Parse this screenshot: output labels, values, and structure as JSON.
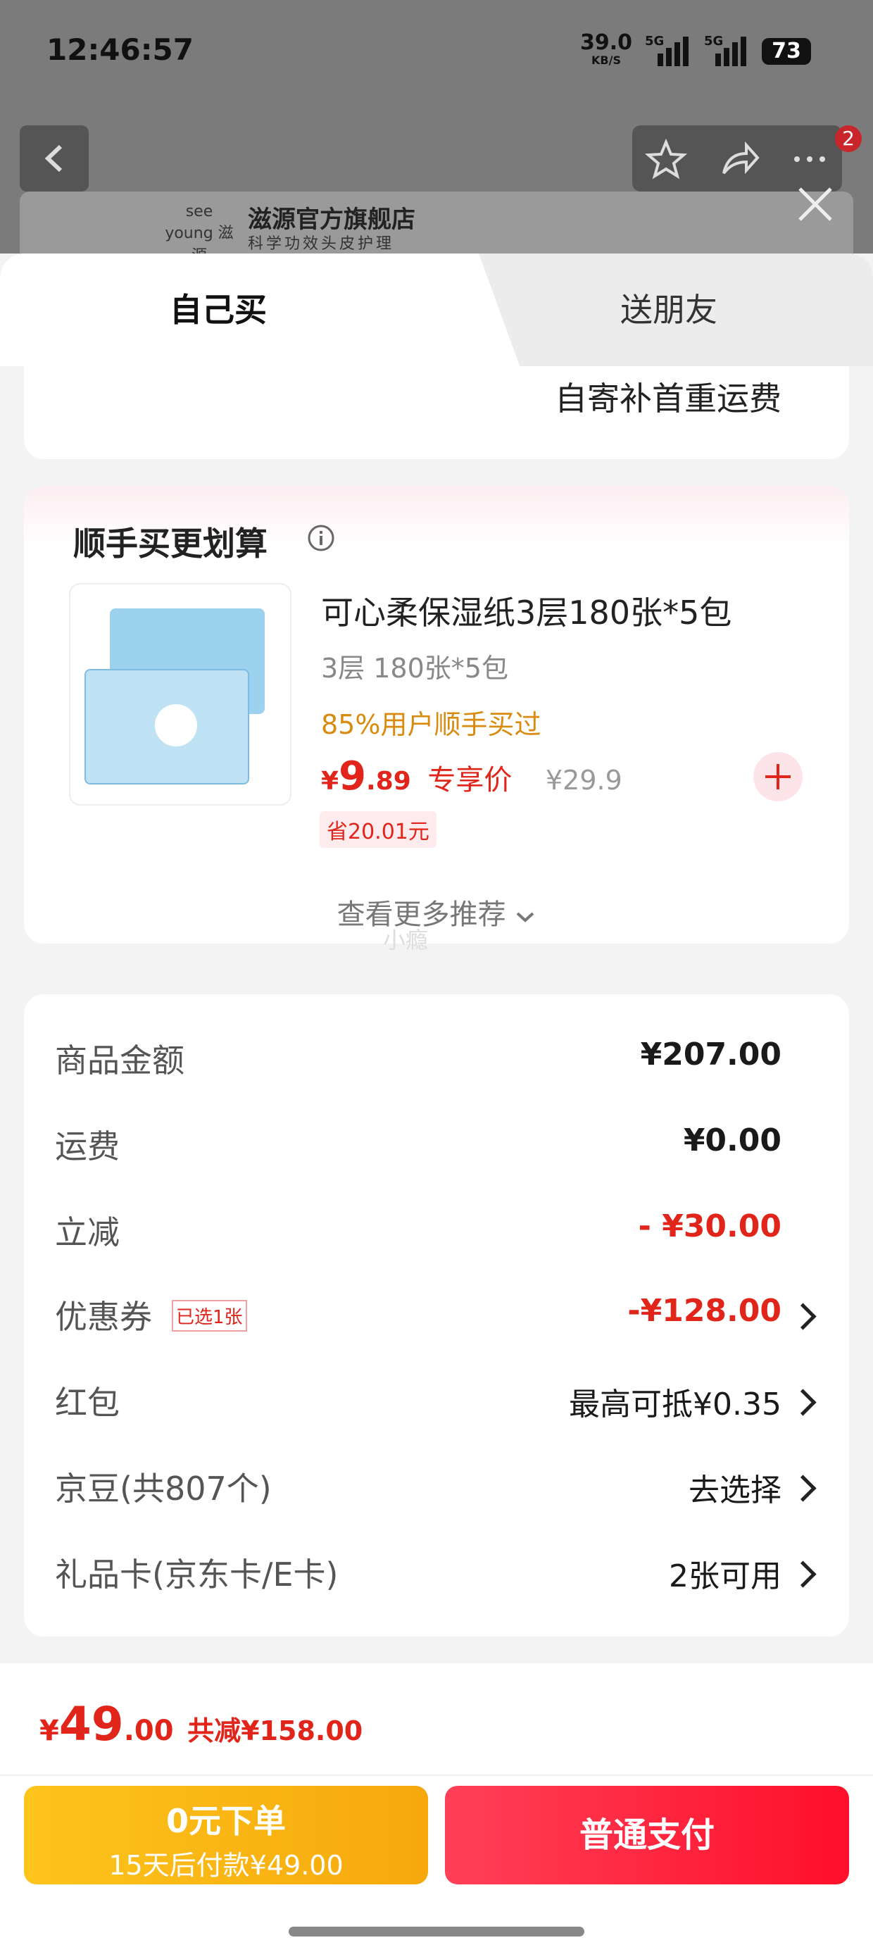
{
  "status_bar": {
    "time": "12:46:57",
    "net_speed": "39.0",
    "net_unit": "KB/S",
    "sig1": "5G",
    "sig2": "5G",
    "battery": "73"
  },
  "store": {
    "name": "滋源官方旗舰店",
    "slogan": "科学功效头皮护理",
    "brand": "see young 滋源"
  },
  "nav": {
    "badge": "2"
  },
  "tabs": {
    "self": "自己买",
    "friend": "送朋友"
  },
  "shipping_note": "自寄补首重运费",
  "addon": {
    "section_title": "顺手买更划算",
    "product_name": "可心柔保湿纸3层180张*5包",
    "spec": "3层 180张*5包",
    "social_proof": "85%用户顺手买过",
    "price_symbol": "¥",
    "price_int": "9",
    "price_dec": ".89",
    "price_tag": "专享价",
    "orig_price": "¥29.9",
    "save": "省20.01元",
    "more": "查看更多推荐",
    "watermark": "小瘾"
  },
  "summary": {
    "rows": [
      {
        "label": "商品金额",
        "value": "¥207.00"
      },
      {
        "label": "运费",
        "value": "¥0.00"
      },
      {
        "label": "立减",
        "value": "- ¥30.00"
      },
      {
        "label": "优惠券",
        "tag": "已选1张",
        "value": "-¥128.00"
      },
      {
        "label": "红包",
        "value": "最高可抵¥0.35"
      },
      {
        "label": "京豆(共807个)",
        "value": "去选择"
      },
      {
        "label": "礼品卡(京东卡/E卡)",
        "value": "2张可用"
      }
    ]
  },
  "footer": {
    "total_symbol": "¥",
    "total_int": "49",
    "total_dec": ".00",
    "discount": "共减¥158.00",
    "pay_later_label": "0元下单",
    "pay_later_sub": "15天后付款¥49.00",
    "pay_now_label": "普通支付"
  },
  "colors": {
    "accent_red": "#e1251b",
    "gold": "#f8b00c",
    "coral": "#ff2d3a"
  }
}
